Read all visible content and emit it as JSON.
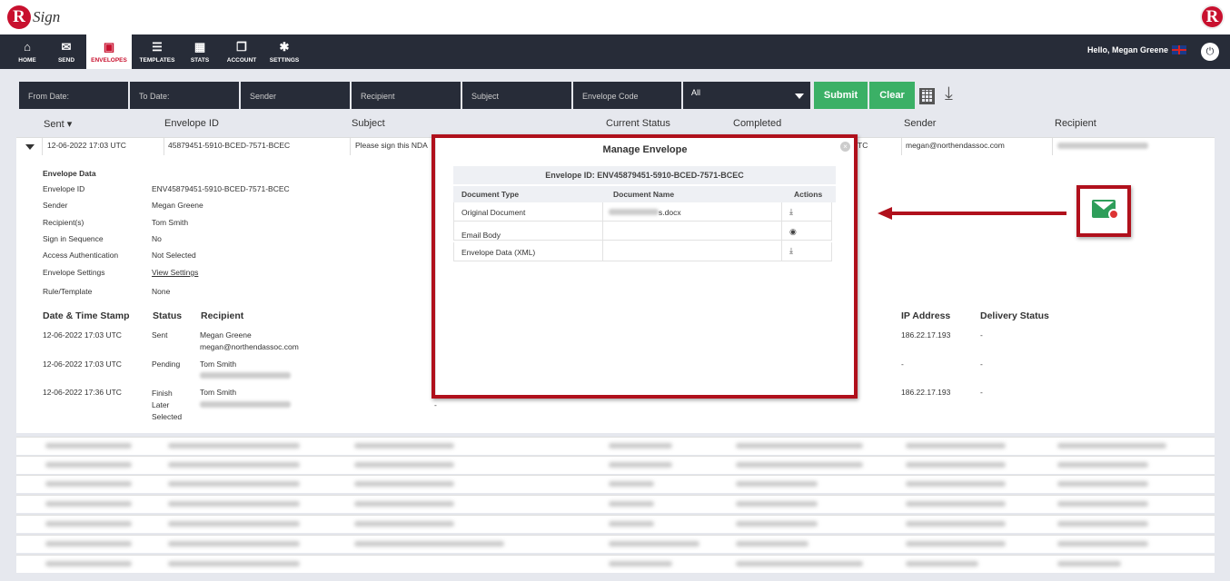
{
  "app": {
    "logo_letter": "R",
    "logo_text": "Sign"
  },
  "nav": {
    "items": [
      {
        "label": "HOME",
        "icon": "home-icon",
        "glyph": "⌂"
      },
      {
        "label": "SEND",
        "icon": "envelope-icon",
        "glyph": "✉"
      },
      {
        "label": "ENVELOPES",
        "icon": "envelopes-icon",
        "glyph": "▣"
      },
      {
        "label": "TEMPLATES",
        "icon": "templates-icon",
        "glyph": "☰"
      },
      {
        "label": "STATS",
        "icon": "stats-icon",
        "glyph": "▦"
      },
      {
        "label": "ACCOUNT",
        "icon": "account-icon",
        "glyph": "❐"
      },
      {
        "label": "SETTINGS",
        "icon": "gear-icon",
        "glyph": "✱"
      }
    ],
    "greeting": "Hello, Megan Greene"
  },
  "filters": {
    "from_date": "From Date:",
    "to_date": "To Date:",
    "sender": "Sender",
    "recipient": "Recipient",
    "subject": "Subject",
    "envelope_code": "Envelope Code",
    "status_selected": "All",
    "submit": "Submit",
    "clear": "Clear"
  },
  "columns": {
    "sent": "Sent",
    "envelope_id": "Envelope ID",
    "subject": "Subject",
    "current_status": "Current Status",
    "completed": "Completed",
    "sender": "Sender",
    "recipient": "Recipient"
  },
  "row": {
    "sent": "12-06-2022 17:03 UTC",
    "envelope_id": "45879451-5910-BCED-7571-BCEC",
    "subject": "Please sign this NDA",
    "completed_tail": "TC",
    "sender": "megan@northendassoc.com"
  },
  "envelope_data": {
    "heading": "Envelope Data",
    "fields": [
      {
        "label": "Envelope ID",
        "value": "ENV45879451-5910-BCED-7571-BCEC"
      },
      {
        "label": "Sender",
        "value": "Megan Greene"
      },
      {
        "label": "Recipient(s)",
        "value": "Tom Smith"
      },
      {
        "label": "Sign in Sequence",
        "value": "No"
      },
      {
        "label": "Access Authentication",
        "value": "Not Selected"
      },
      {
        "label": "Envelope Settings",
        "value": "View Settings"
      },
      {
        "label": "Rule/Template",
        "value": "None"
      }
    ]
  },
  "history": {
    "headers": {
      "timestamp": "Date & Time Stamp",
      "status": "Status",
      "recipient": "Recipient",
      "ip": "IP Address",
      "delivery": "Delivery Status"
    },
    "rows": [
      {
        "timestamp": "12-06-2022 17:03 UTC",
        "status": "Sent",
        "name": "Megan Greene",
        "email": "megan@northendassoc.com",
        "ip": "186.22.17.193",
        "delivery": "-"
      },
      {
        "timestamp": "12-06-2022 17:03 UTC",
        "status": "Pending",
        "name": "Tom Smith",
        "email": "",
        "ip": "-",
        "delivery": "-"
      },
      {
        "timestamp": "12-06-2022 17:36 UTC",
        "status": "Finish Later Selected",
        "name": "Tom Smith",
        "email": "",
        "ip": "186.22.17.193",
        "delivery": "-"
      }
    ],
    "dash": "-"
  },
  "modal": {
    "title": "Manage Envelope",
    "envelope_id": "Envelope ID: ENV45879451-5910-BCED-7571-BCEC",
    "headers": {
      "type": "Document Type",
      "name": "Document Name",
      "actions": "Actions"
    },
    "rows": [
      {
        "type": "Original Document",
        "name": "s.docx",
        "action": "download-icon"
      },
      {
        "type": "Email Body",
        "name": "",
        "action": "eye-icon"
      },
      {
        "type": "Envelope Data (XML)",
        "name": "",
        "action": "download-icon"
      }
    ]
  },
  "colors": {
    "nav_bg": "#272c38",
    "accent_red": "#c8102e",
    "green": "#3bb066",
    "annotation_red": "#b0101c"
  }
}
